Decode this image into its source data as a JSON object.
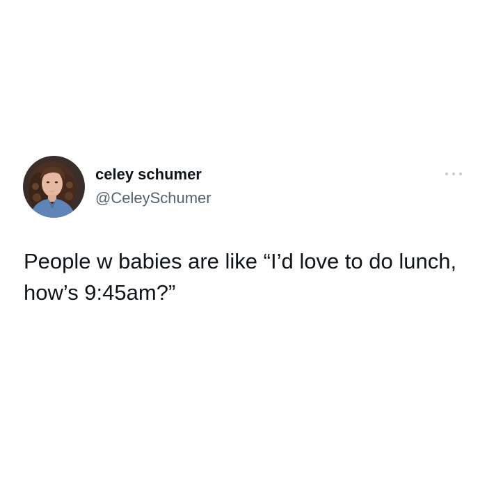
{
  "tweet": {
    "author": {
      "display_name": "celey schumer",
      "handle": "@CeleySchumer",
      "avatar_icon": "profile-photo-avatar"
    },
    "more_icon": "more-options-icon",
    "text": "People w babies are like “I’d love to do lunch, how’s 9:45am?”"
  },
  "colors": {
    "background": "#ffffff",
    "primary_text": "#0f1419",
    "secondary_text": "#536471",
    "icon_gray": "#c4cdd4"
  }
}
